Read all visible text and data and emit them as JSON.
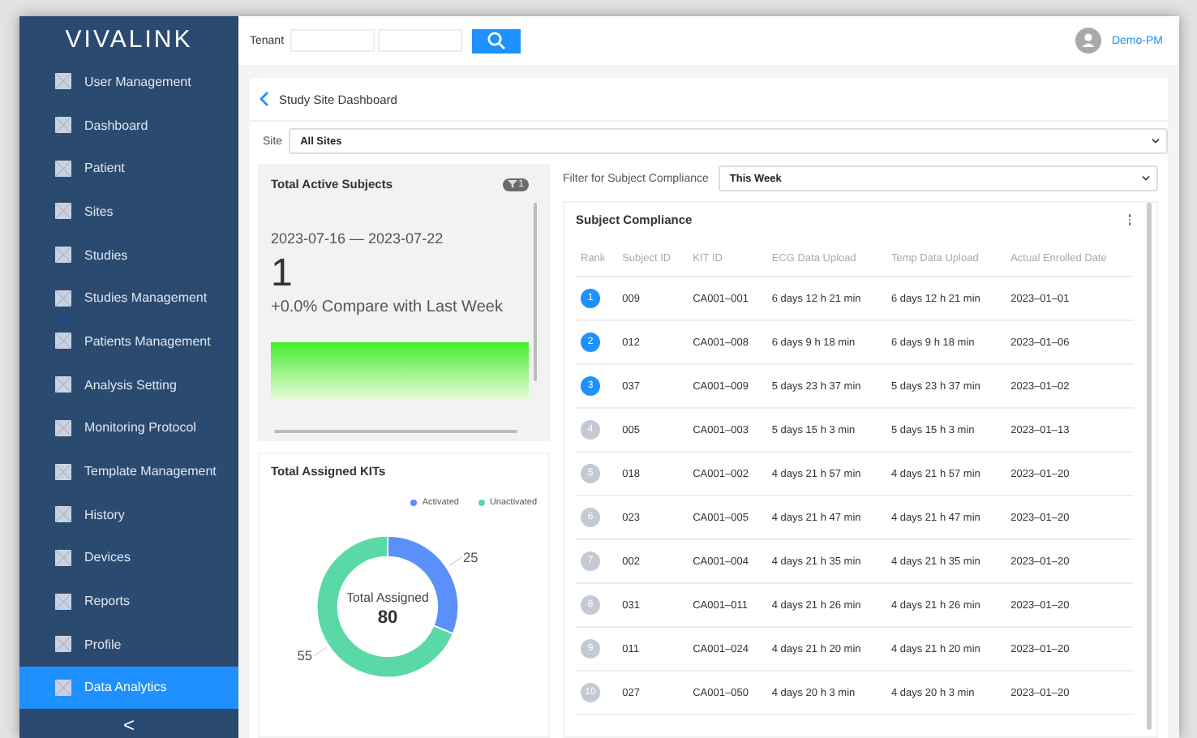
{
  "sidebar": {
    "logo": "VIVALINK",
    "items": [
      {
        "label": "User Management",
        "selected": false
      },
      {
        "label": "Dashboard",
        "selected": false
      },
      {
        "label": "Patient",
        "selected": false
      },
      {
        "label": "Sites",
        "selected": false
      },
      {
        "label": "Studies",
        "selected": false
      },
      {
        "label": "Studies Management",
        "selected": false
      },
      {
        "label": "Patients Management",
        "selected": false
      },
      {
        "label": "Analysis Setting",
        "selected": false
      },
      {
        "label": "Monitoring Protocol",
        "selected": false
      },
      {
        "label": "Template Management",
        "selected": false
      },
      {
        "label": "History",
        "selected": false
      },
      {
        "label": "Devices",
        "selected": false
      },
      {
        "label": "Reports",
        "selected": false
      },
      {
        "label": "Profile",
        "selected": false
      },
      {
        "label": "Data Analytics",
        "selected": true
      }
    ],
    "collapse": "<"
  },
  "topbar": {
    "tenant_label": "Tenant",
    "user": "Demo-PM"
  },
  "page": {
    "title": "Study Site Dashboard",
    "site_label": "Site",
    "site_value": "All Sites"
  },
  "active_subjects": {
    "title": "Total Active Subjects",
    "badge": "1",
    "range": "2023-07-16 — 2023-07-22",
    "count": "1",
    "compare": "+0.0% Compare with Last Week"
  },
  "kits": {
    "title": "Total Assigned KITs",
    "center_label": "Total Assigned",
    "center_value": "80",
    "chart_data": {
      "type": "donut",
      "categories": [
        "Activated",
        "Unactivated"
      ],
      "values": [
        25,
        55
      ],
      "colors": [
        "#5b8ff9",
        "#5ad8a6"
      ],
      "data_labels": true
    }
  },
  "compliance": {
    "filter_label": "Filter for Subject Compliance",
    "filter_value": "This Week",
    "title": "Subject Compliance",
    "columns": [
      "Rank",
      "Subject ID",
      "KIT ID",
      "ECG Data Upload",
      "Temp Data Upload",
      "Actual Enrolled Date"
    ],
    "rows": [
      {
        "highlighted": true,
        "cells": [
          "1",
          "009",
          "CA001–001",
          "6 days 12 h 21 min",
          "6 days 12 h 21 min",
          "2023–01–01"
        ]
      },
      {
        "highlighted": true,
        "cells": [
          "2",
          "012",
          "CA001–008",
          "6 days 9 h 18 min",
          "6 days 9 h 18 min",
          "2023–01–06"
        ]
      },
      {
        "highlighted": true,
        "cells": [
          "3",
          "037",
          "CA001–009",
          "5 days 23 h 37 min",
          "5 days 23 h 37 min",
          "2023–01–02"
        ]
      },
      {
        "highlighted": false,
        "cells": [
          "4",
          "005",
          "CA001–003",
          "5 days 15 h 3 min",
          "5 days 15 h 3 min",
          "2023–01–13"
        ]
      },
      {
        "highlighted": false,
        "cells": [
          "5",
          "018",
          "CA001–002",
          "4 days 21 h 57 min",
          "4 days 21 h 57 min",
          "2023–01–20"
        ]
      },
      {
        "highlighted": false,
        "cells": [
          "6",
          "023",
          "CA001–005",
          "4 days 21 h 47 min",
          "4 days 21 h 47 min",
          "2023–01–20"
        ]
      },
      {
        "highlighted": false,
        "cells": [
          "7",
          "002",
          "CA001–004",
          "4 days 21 h 35 min",
          "4 days 21 h 35 min",
          "2023–01–20"
        ]
      },
      {
        "highlighted": false,
        "cells": [
          "8",
          "031",
          "CA001–011",
          "4 days 21 h 26 min",
          "4 days 21 h 26 min",
          "2023–01–20"
        ]
      },
      {
        "highlighted": false,
        "cells": [
          "9",
          "011",
          "CA001–024",
          "4 days 21 h 20 min",
          "4 days 21 h 20 min",
          "2023–01–20"
        ]
      },
      {
        "highlighted": false,
        "cells": [
          "10",
          "027",
          "CA001–050",
          "4 days 20 h 3 min",
          "4 days 20 h 3 min",
          "2023–01–20"
        ]
      }
    ]
  }
}
